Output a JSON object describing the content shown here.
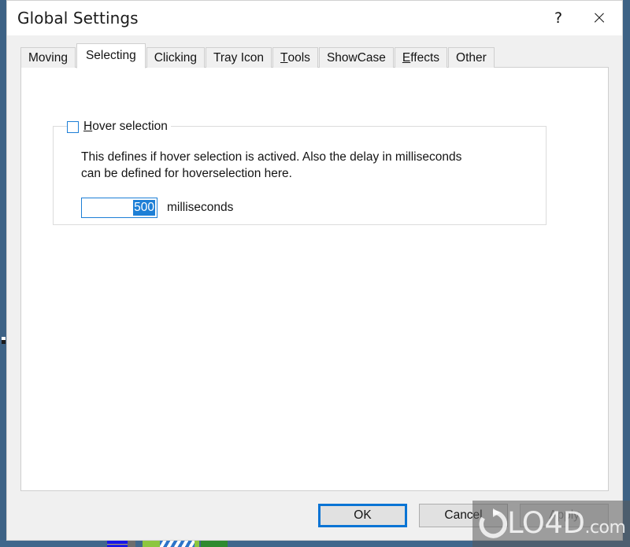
{
  "window": {
    "title": "Global Settings",
    "help_button": "?",
    "help_icon": "question-mark-icon",
    "close_icon": "close-x-icon"
  },
  "tabs": [
    {
      "label": "Moving",
      "mnemonic": "",
      "selected": false
    },
    {
      "label": "Selecting",
      "mnemonic": "",
      "selected": true
    },
    {
      "label": "Clicking",
      "mnemonic": "",
      "selected": false
    },
    {
      "label": "Tray Icon",
      "mnemonic": "",
      "selected": false
    },
    {
      "label": "Tools",
      "mnemonic": "T",
      "selected": false
    },
    {
      "label": "ShowCase",
      "mnemonic": "",
      "selected": false
    },
    {
      "label": "Effects",
      "mnemonic": "E",
      "selected": false
    },
    {
      "label": "Other",
      "mnemonic": "",
      "selected": false
    }
  ],
  "selecting_tab": {
    "group": {
      "checkbox_label_mnemonic": "H",
      "checkbox_label_rest": "over selection",
      "checkbox_checked": false,
      "description_line1": "This defines if hover selection is actived. Also the delay in milliseconds",
      "description_line2": "can be defined for hoverselection here.",
      "delay_value": "500",
      "delay_unit": "milliseconds"
    }
  },
  "buttons": {
    "ok": "OK",
    "cancel": "Cancel",
    "apply": "Apply"
  },
  "watermark": {
    "text": "LO4D",
    "suffix": ".com",
    "logo_icon": "circular-arrow-icon"
  },
  "colors": {
    "accent_blue": "#1d7fd6",
    "focus_blue": "#0a74d4",
    "desktop_blue": "#3d6285",
    "client_grey": "#f0f0f0"
  }
}
